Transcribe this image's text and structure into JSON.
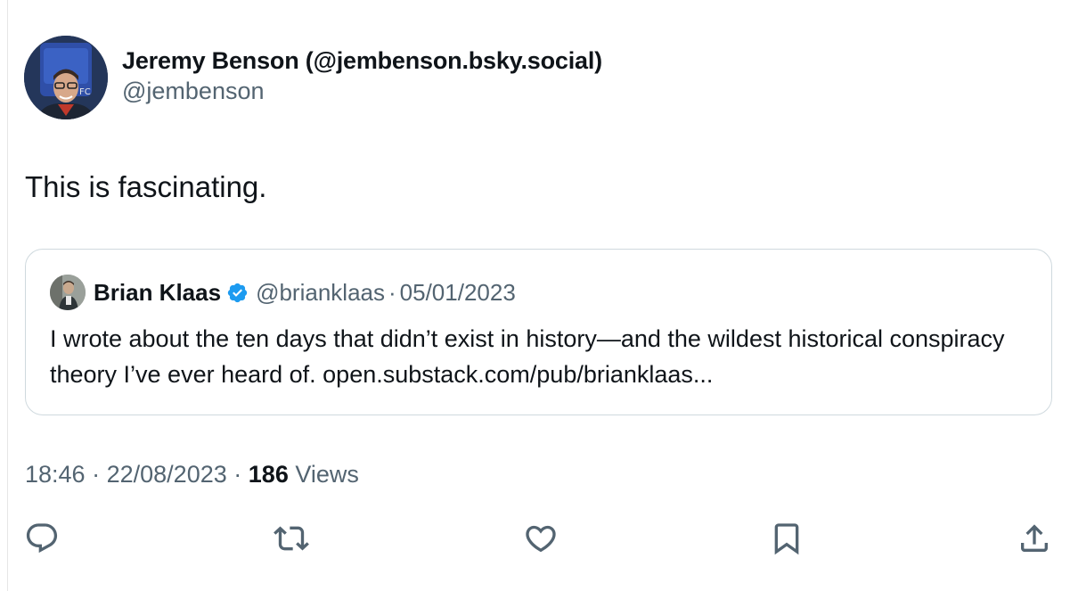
{
  "author": {
    "display_name": "Jeremy Benson (@jembenson.bsky.social)",
    "handle": "@jembenson"
  },
  "tweet": {
    "text": "This is fascinating."
  },
  "quote": {
    "name": "Brian Klaas",
    "verified": true,
    "handle": "@brianklaas",
    "separator": "·",
    "date": "05/01/2023",
    "text": "I wrote about the ten days that didn’t exist in history—and the wildest historical conspiracy theory I’ve ever heard of. open.substack.com/pub/brianklaas..."
  },
  "meta": {
    "time": "18:46",
    "sep1": "·",
    "date": "22/08/2023",
    "sep2": "·",
    "views_count": "186",
    "views_label": "Views"
  },
  "actions": [
    {
      "icon": "reply-icon"
    },
    {
      "icon": "retweet-icon"
    },
    {
      "icon": "like-icon"
    },
    {
      "icon": "bookmark-icon"
    },
    {
      "icon": "share-icon"
    }
  ],
  "colors": {
    "text": "#0f1419",
    "muted": "#536471",
    "border": "#cfd9de",
    "verified": "#1d9bf0"
  }
}
